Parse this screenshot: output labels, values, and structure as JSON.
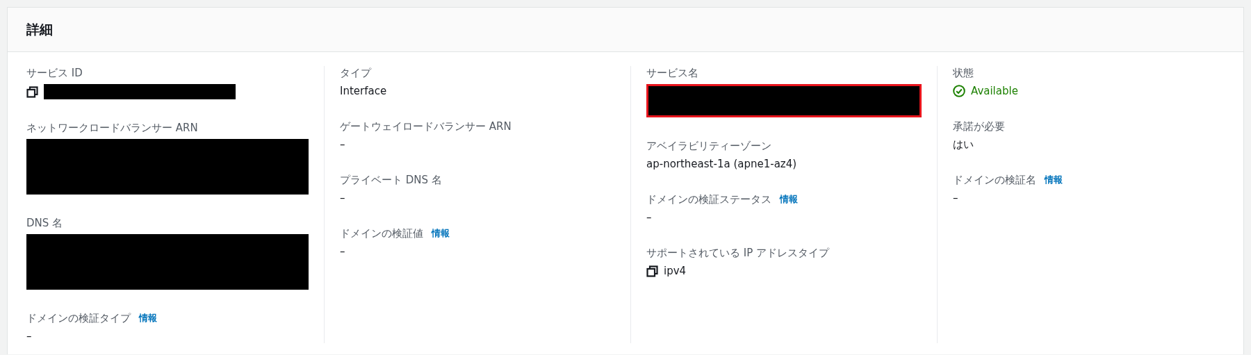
{
  "panel": {
    "title": "詳細"
  },
  "columns": [
    {
      "fields": [
        {
          "label": "サービス ID",
          "kind": "copy-redacted"
        },
        {
          "label": "ネットワークロードバランサー ARN",
          "kind": "redacted-block"
        },
        {
          "label": "DNS 名",
          "kind": "redacted-block"
        },
        {
          "label": "ドメインの検証タイプ",
          "info": "情報",
          "kind": "text",
          "value": "–"
        }
      ]
    },
    {
      "fields": [
        {
          "label": "タイプ",
          "kind": "text",
          "value": "Interface"
        },
        {
          "label": "ゲートウェイロードバランサー ARN",
          "kind": "text",
          "value": "–"
        },
        {
          "label": "プライベート DNS 名",
          "kind": "text",
          "value": "–"
        },
        {
          "label": "ドメインの検証値",
          "info": "情報",
          "kind": "text",
          "value": "–"
        }
      ]
    },
    {
      "fields": [
        {
          "label": "サービス名",
          "kind": "redacted-block",
          "highlighted": true
        },
        {
          "label": "アベイラビリティーゾーン",
          "kind": "text",
          "value": "ap-northeast-1a (apne1-az4)"
        },
        {
          "label": "ドメインの検証ステータス",
          "info": "情報",
          "kind": "text",
          "value": "–"
        },
        {
          "label": "サポートされている IP アドレスタイプ",
          "kind": "copy-text",
          "value": "ipv4"
        }
      ]
    },
    {
      "fields": [
        {
          "label": "状態",
          "kind": "status",
          "value": "Available"
        },
        {
          "label": "承諾が必要",
          "kind": "text",
          "value": "はい"
        },
        {
          "label": "ドメインの検証名",
          "info": "情報",
          "kind": "text",
          "value": "–"
        }
      ]
    }
  ]
}
